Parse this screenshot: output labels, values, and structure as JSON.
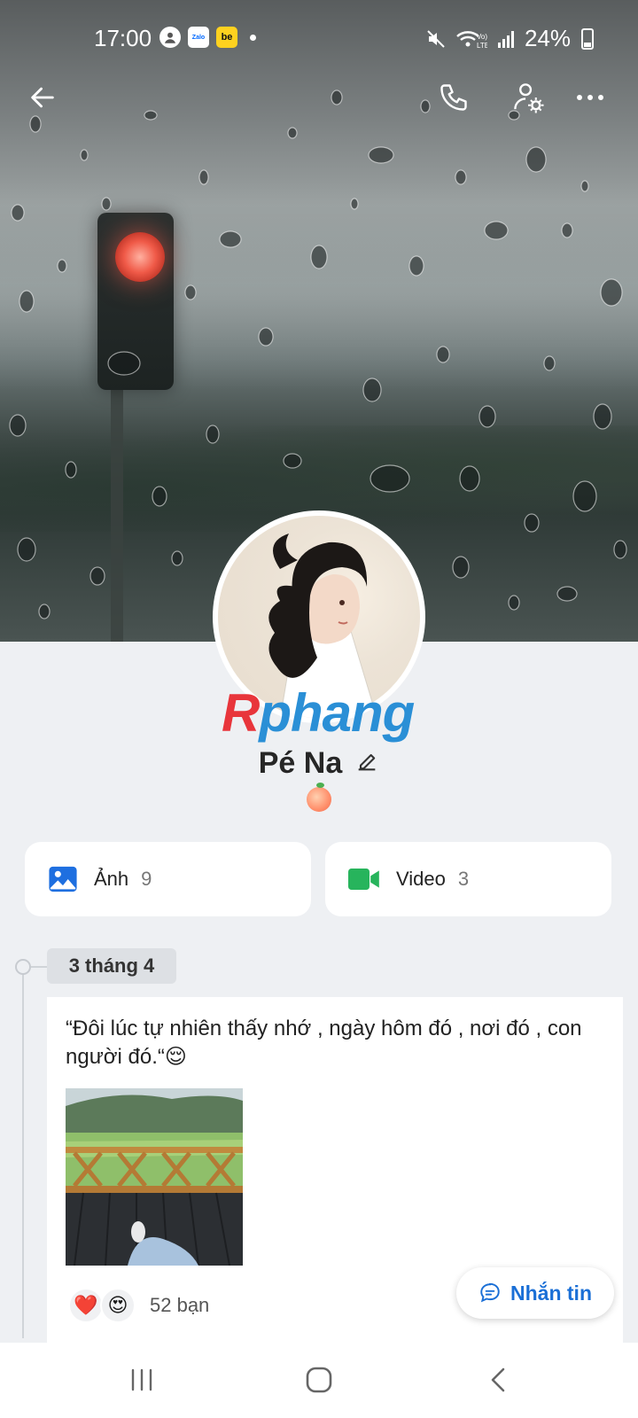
{
  "status_bar": {
    "time": "17:00",
    "battery": "24%",
    "zalo_label": "Zalo",
    "be_label": "be"
  },
  "profile": {
    "name": "Pé Na",
    "watermark_part1": "R",
    "watermark_part2": "phang"
  },
  "media": [
    {
      "label": "Ảnh",
      "count": "9"
    },
    {
      "label": "Video",
      "count": "3"
    }
  ],
  "timeline": {
    "date": "3 tháng 4",
    "post_text": "“Đôi lúc tự nhiên thấy nhớ , ngày hôm đó , nơi đó , con người đó.“😌",
    "reaction_count": "52 bạn",
    "reactions": [
      "❤️",
      "😍"
    ]
  },
  "message_button": {
    "label": "Nhắn tin"
  },
  "colors": {
    "accent": "#1a6fd6",
    "photo_icon": "#1e6fe0",
    "video_icon": "#27b45c",
    "background": "#eef0f3"
  },
  "icons": [
    "back-arrow-icon",
    "phone-icon",
    "user-settings-icon",
    "more-icon",
    "photo-icon",
    "video-icon",
    "edit-pencil-icon",
    "chat-bubble-icon"
  ]
}
